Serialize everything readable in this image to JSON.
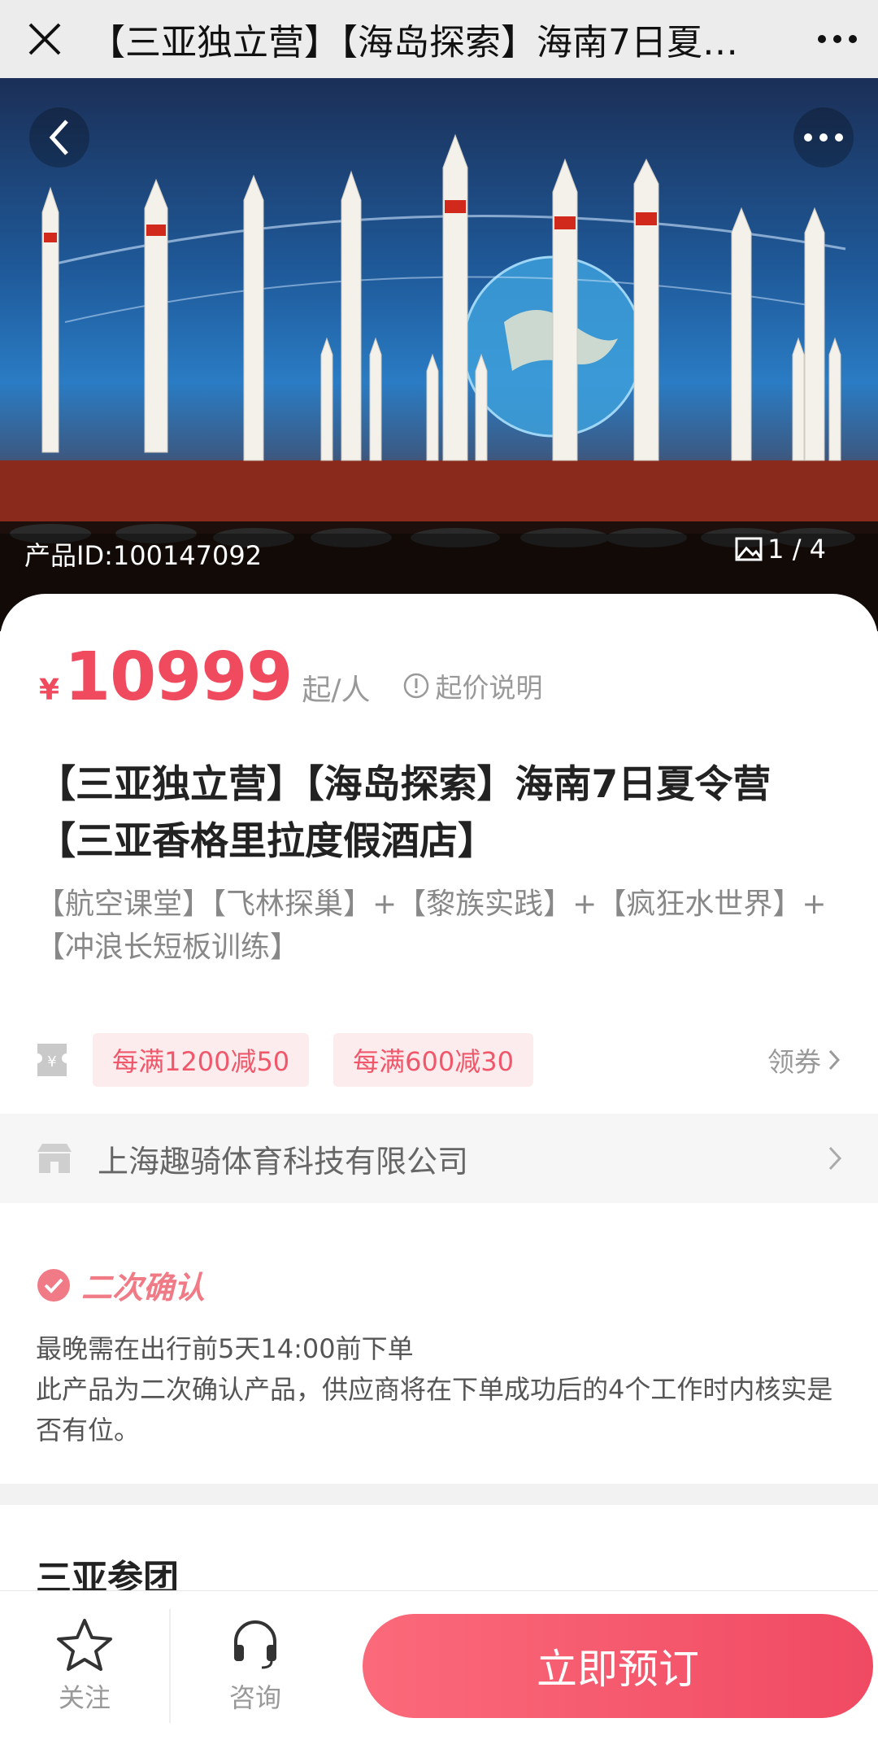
{
  "topbar": {
    "title": "【三亚独立营】【海岛探索】海南7日夏…"
  },
  "hero": {
    "product_id": "产品ID:100147092",
    "image_counter": "1 / 4"
  },
  "price": {
    "currency": "¥",
    "amount": "10999",
    "unit": "起/人",
    "note": "起价说明"
  },
  "product": {
    "title": "【三亚独立营】【海岛探索】海南7日夏令营【三亚香格里拉度假酒店】",
    "subtitle": "【航空课堂】【飞林探巢】+【黎族实践】+【疯狂水世界】+【冲浪长短板训练】"
  },
  "coupons": {
    "items": [
      "每满1200减50",
      "每满600减30"
    ],
    "get_label": "领券"
  },
  "supplier": {
    "name": "上海趣骑体育科技有限公司"
  },
  "confirm": {
    "badge": "二次确认",
    "line1": "最晚需在出行前5天14:00前下单",
    "line2": "此产品为二次确认产品，供应商将在下单成功后的4个工作时内核实是否有位。"
  },
  "group": {
    "title": "三亚参团"
  },
  "bottom": {
    "follow": "关注",
    "consult": "咨询",
    "book": "立即预订"
  },
  "colors": {
    "accent": "#f04a5e",
    "book_start": "#fb6a7a",
    "book_end": "#f04a63"
  }
}
